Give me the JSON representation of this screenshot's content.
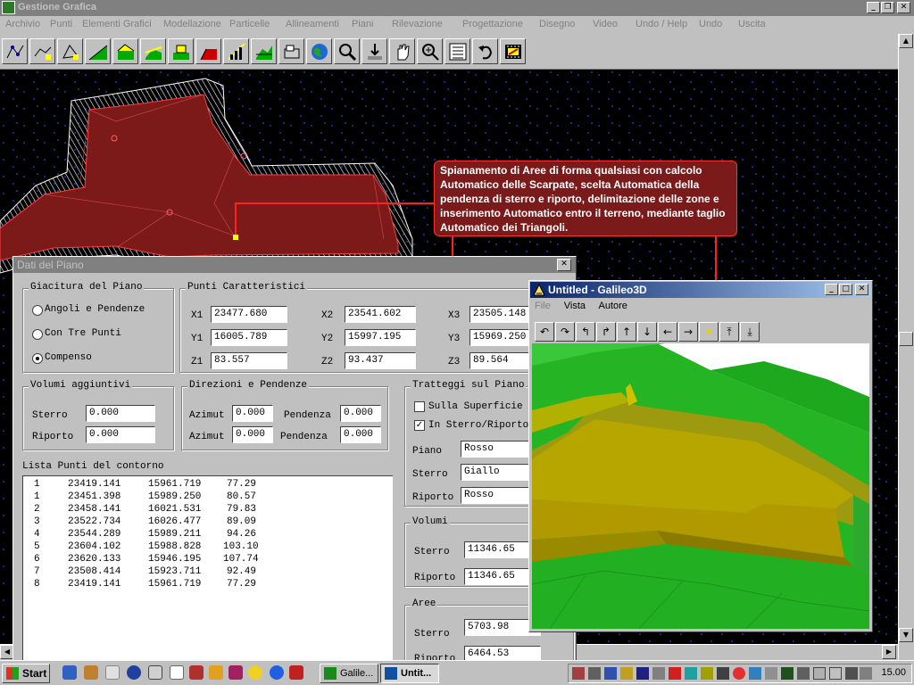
{
  "app": {
    "title": "Gestione Grafica",
    "menu": [
      "Archivio",
      "Punti",
      "Elementi Grafici",
      "Modellazione",
      "Particelle",
      "Allineamenti",
      "Piani",
      "Rilevazione",
      "Progettazione",
      "Disegno",
      "Video",
      "Undo / Help",
      "Undo",
      "Uscita"
    ]
  },
  "toolbar": {
    "icons": [
      "points-insert-icon",
      "points-edit-icon",
      "vertices-icon",
      "terrain-icon",
      "surface-icon",
      "slope-icon",
      "grid-icon",
      "embankment-icon",
      "contours-icon",
      "profile-icon",
      "section-icon",
      "globe-icon",
      "zoom-icon",
      "pick-icon",
      "pan-hand-icon",
      "zoom-plus-icon",
      "list-icon",
      "undo-icon",
      "film-icon"
    ]
  },
  "callout": {
    "text": "Spianamento di Aree di forma qualsiasi con calcolo Automatico delle Scarpate, scelta Automatica della pendenza di sterro e riporto, delimitazione delle zone e inserimento Automatico entro il terreno, mediante taglio Automatico dei Triangoli."
  },
  "dialog": {
    "title": "Dati del Piano",
    "giacitura": {
      "label": "Giacitura del Piano",
      "options": [
        "Angoli e Pendenze",
        "Con Tre Punti",
        "Compenso"
      ],
      "selected": 2
    },
    "punti": {
      "label": "Punti Caratteristici",
      "x1_label": "X1",
      "x1": "23477.680",
      "y1_label": "Y1",
      "y1": "16005.789",
      "z1_label": "Z1",
      "z1": "83.557",
      "x2_label": "X2",
      "x2": "23541.602",
      "y2_label": "Y2",
      "y2": "15997.195",
      "z2_label": "Z2",
      "z2": "93.437",
      "x3_label": "X3",
      "x3": "23505.148",
      "y3_label": "Y3",
      "y3": "15969.250",
      "z3_label": "Z3",
      "z3": "89.564"
    },
    "volumi_agg": {
      "label": "Volumi aggiuntivi",
      "sterro_label": "Sterro",
      "sterro": "0.000",
      "riporto_label": "Riporto",
      "riporto": "0.000"
    },
    "direzioni": {
      "label": "Direzioni e Pendenze",
      "azimut1_label": "Azimut",
      "azimut1": "0.000",
      "pendenza1_label": "Pendenza",
      "pendenza1": "0.000",
      "azimut2_label": "Azimut",
      "azimut2": "0.000",
      "pendenza2_label": "Pendenza",
      "pendenza2": "0.000"
    },
    "tratteggi": {
      "label": "Tratteggi sul Piano",
      "sulla_superficie": "Sulla Superficie",
      "sulla_superficie_checked": false,
      "in_sterro": "In Sterro/Riporto",
      "in_sterro_checked": true,
      "piano_label": "Piano",
      "piano": "Rosso",
      "sterro_label": "Sterro",
      "sterro": "Giallo",
      "riporto_label": "Riporto",
      "riporto": "Rosso"
    },
    "lista": {
      "label": "Lista Punti del contorno",
      "rows": [
        [
          "1",
          "23419.141",
          "15961.719",
          "77.29"
        ],
        [
          "1",
          "23451.398",
          "15989.250",
          "80.57"
        ],
        [
          "2",
          "23458.141",
          "16021.531",
          "79.83"
        ],
        [
          "3",
          "23522.734",
          "16026.477",
          "89.09"
        ],
        [
          "4",
          "23544.289",
          "15989.211",
          "94.26"
        ],
        [
          "5",
          "23604.102",
          "15988.828",
          "103.10"
        ],
        [
          "6",
          "23620.133",
          "15946.195",
          "107.74"
        ],
        [
          "7",
          "23508.414",
          "15923.711",
          "92.49"
        ],
        [
          "8",
          "23419.141",
          "15961.719",
          "77.29"
        ]
      ]
    },
    "volumi": {
      "label": "Volumi",
      "sterro_label": "Sterro",
      "sterro": "11346.65",
      "riporto_label": "Riporto",
      "riporto": "11346.65"
    },
    "aree": {
      "label": "Aree",
      "sterro_label": "Sterro",
      "sterro": "5703.98",
      "riporto_label": "Riporto",
      "riporto": "6464.53"
    }
  },
  "galileo": {
    "title": "Untitled - Galileo3D",
    "menu": [
      "File",
      "Vista",
      "Autore"
    ],
    "tools": [
      "↶",
      "↷",
      "↰",
      "↱",
      "↑",
      "↓",
      "←",
      "→",
      "✶",
      "⤒",
      "⤓"
    ]
  },
  "taskbar": {
    "start": "Start",
    "tasks": [
      "Galile...",
      "Untit..."
    ],
    "clock": "15.00"
  },
  "colors": {
    "drawing_bg": "#000000",
    "hatch": "#ffffff",
    "area_fill": "#8b1f1f",
    "callout_bg": "#7a1a1a",
    "terrain_green": "#22b422",
    "platform_yellow": "#b8a000"
  }
}
